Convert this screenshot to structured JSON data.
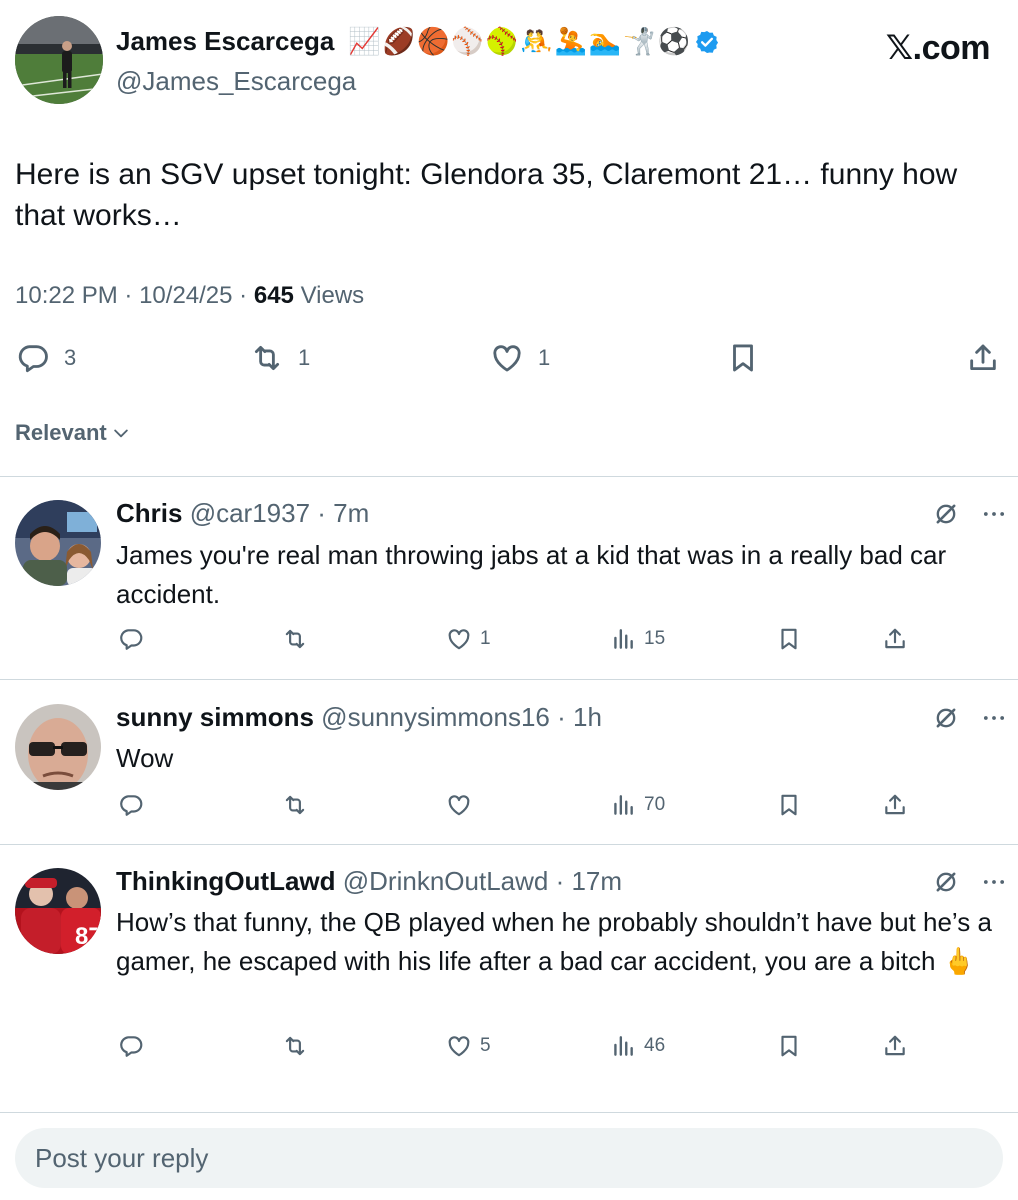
{
  "brand": {
    "site": "𝕏.com"
  },
  "post": {
    "author_name": "James Escarcega",
    "author_emojis": [
      "📈",
      "🏈",
      "🏀",
      "⚾",
      "🥎",
      "🤼",
      "🤽",
      "🏊",
      "🤺",
      "⚽"
    ],
    "handle": "@James_Escarcega",
    "text": "Here is an SGV upset tonight: Glendora 35, Claremont 21… funny how that works…",
    "time": "10:22 PM",
    "date": "10/24/25",
    "views_count": "645",
    "views_label": "Views",
    "replies": "3",
    "reposts": "1",
    "likes": "1",
    "accent": "#1d9bf0"
  },
  "sort": {
    "label": "Relevant"
  },
  "replies": [
    {
      "name": "Chris",
      "handle": "@car1937",
      "time": "7m",
      "text": "James you're real man throwing jabs at a kid that was in a really bad car accident.",
      "likes": "1",
      "views": "15"
    },
    {
      "name": "sunny simmons",
      "handle": "@sunnysimmons16",
      "time": "1h",
      "text": "Wow",
      "likes": "",
      "views": "70"
    },
    {
      "name": "ThinkingOutLawd",
      "handle": "@DrinknOutLawd",
      "time": "17m",
      "text": "How’s that funny, the QB played when he probably shouldn’t have but he’s a gamer, he escaped with his life after a bad car accident, you are a bitch 🖕",
      "likes": "5",
      "views": "46"
    }
  ],
  "composer": {
    "placeholder": "Post your reply"
  },
  "icons": {
    "reply": "speech-bubble-icon",
    "repost": "repost-arrows-icon",
    "like": "heart-icon",
    "views": "bar-chart-icon",
    "bookmark": "bookmark-icon",
    "share": "share-upload-icon",
    "grok": "grok-slash-icon",
    "more": "more-dots-icon",
    "verified": "verified-badge-icon",
    "chevron": "chevron-down-icon"
  }
}
